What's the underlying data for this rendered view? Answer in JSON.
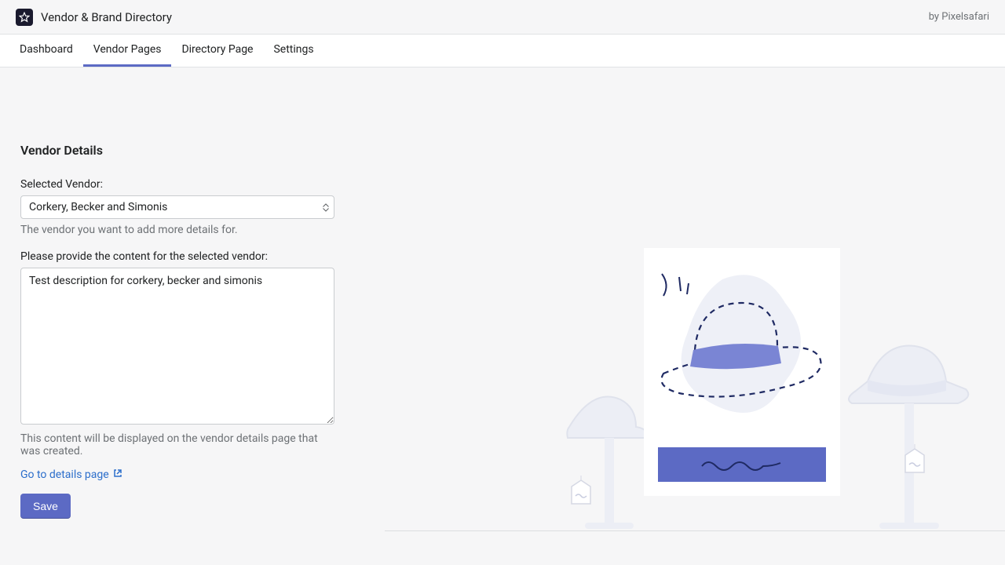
{
  "header": {
    "app_title": "Vendor & Brand Directory",
    "byline": "by Pixelsafari"
  },
  "tabs": {
    "dashboard": "Dashboard",
    "vendor_pages": "Vendor Pages",
    "directory_page": "Directory Page",
    "settings": "Settings"
  },
  "form": {
    "section_title": "Vendor Details",
    "vendor_label": "Selected Vendor:",
    "vendor_value": "Corkery, Becker and Simonis",
    "vendor_help": "The vendor you want to add more details for.",
    "content_label": "Please provide the content for the selected vendor:",
    "content_value": "Test description for corkery, becker and simonis",
    "content_help": "This content will be displayed on the vendor details page that was created.",
    "details_link": "Go to details page",
    "save_label": "Save"
  }
}
